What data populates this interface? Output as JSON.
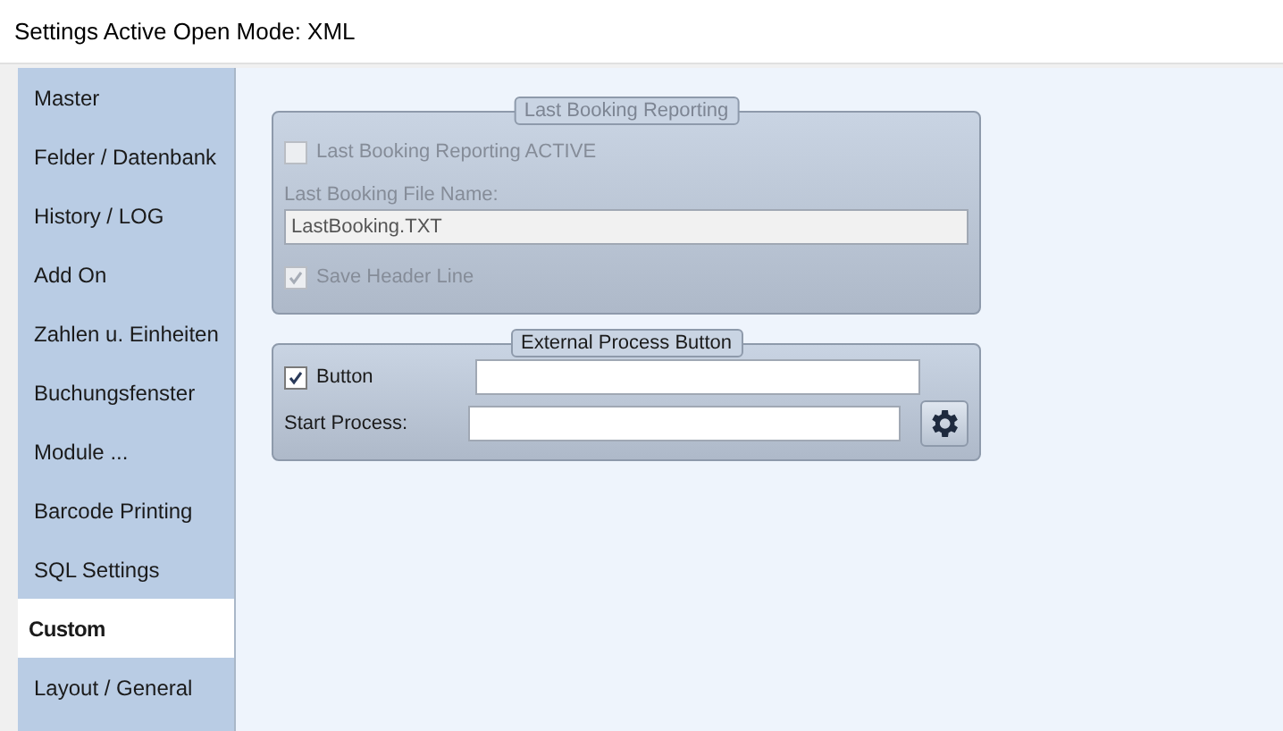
{
  "window": {
    "title": "Settings Active Open Mode: XML"
  },
  "sidebar": {
    "items": [
      {
        "label": "Master",
        "selected": false
      },
      {
        "label": "Felder / Datenbank",
        "selected": false
      },
      {
        "label": "History / LOG",
        "selected": false
      },
      {
        "label": "Add On",
        "selected": false
      },
      {
        "label": "Zahlen u. Einheiten",
        "selected": false
      },
      {
        "label": "Buchungsfenster",
        "selected": false
      },
      {
        "label": "Module ...",
        "selected": false
      },
      {
        "label": "Barcode Printing",
        "selected": false
      },
      {
        "label": "SQL Settings",
        "selected": false
      },
      {
        "label": "Custom",
        "selected": true
      },
      {
        "label": "Layout / General",
        "selected": false
      }
    ]
  },
  "groups": [
    {
      "title": "Last Booking Reporting",
      "disabled": true,
      "rows": [
        {
          "kind": "checkbox",
          "label": "Last Booking Reporting ACTIVE",
          "checked": false
        },
        {
          "kind": "stacked_field",
          "label": "Last Booking File Name:",
          "value": "LastBooking.TXT"
        },
        {
          "kind": "checkbox",
          "label": "Save Header Line",
          "checked": true
        }
      ]
    },
    {
      "title": "External Process Button",
      "disabled": false,
      "rows": [
        {
          "kind": "checkbox_field",
          "label": "Button",
          "checked": true
        },
        {
          "kind": "field_button",
          "label": "Start Process:"
        }
      ]
    }
  ]
}
